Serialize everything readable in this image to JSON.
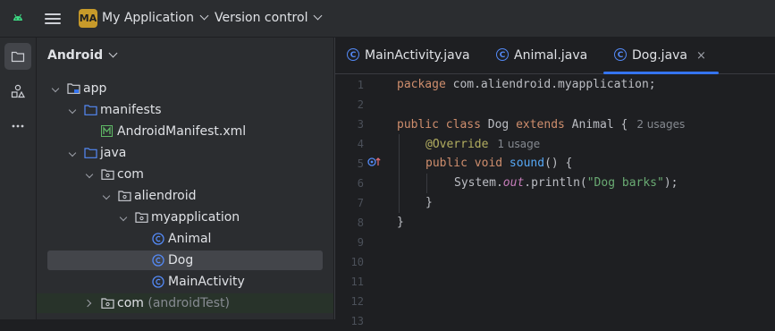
{
  "topbar": {
    "project_badge": "MA",
    "project_name": "My Application",
    "vcs_label": "Version control"
  },
  "project_panel": {
    "title": "Android",
    "tree": [
      {
        "label": "app",
        "icon": "module-folder-icon",
        "expanded": true
      },
      {
        "label": "manifests",
        "icon": "folder-icon",
        "expanded": true
      },
      {
        "label": "AndroidManifest.xml",
        "icon": "manifest-file-icon"
      },
      {
        "label": "java",
        "icon": "folder-icon",
        "expanded": true
      },
      {
        "label": "com",
        "icon": "package-icon",
        "expanded": true
      },
      {
        "label": "aliendroid",
        "icon": "package-icon",
        "expanded": true
      },
      {
        "label": "myapplication",
        "icon": "package-icon",
        "expanded": true
      },
      {
        "label": "Animal",
        "icon": "class-icon"
      },
      {
        "label": "Dog",
        "icon": "class-icon",
        "selected": true
      },
      {
        "label": "MainActivity",
        "icon": "class-icon"
      },
      {
        "label": "com",
        "suffix": "(androidTest)",
        "icon": "package-icon",
        "expanded": false
      }
    ]
  },
  "editor": {
    "tabs": [
      {
        "label": "MainActivity.java",
        "active": false
      },
      {
        "label": "Animal.java",
        "active": false
      },
      {
        "label": "Dog.java",
        "active": true,
        "close": "×"
      }
    ],
    "line_numbers": [
      "1",
      "2",
      "3",
      "4",
      "5",
      "6",
      "7",
      "8",
      "9",
      "10",
      "11",
      "12",
      "13"
    ],
    "code": {
      "l1_kw": "package",
      "l1_rest": " com.aliendroid.myapplication;",
      "l3_kw1": "public class",
      "l3_name": " Dog ",
      "l3_kw2": "extends",
      "l3_rest": " Animal {",
      "l3_hint": "2 usages",
      "l4_ann": "@Override",
      "l4_hint": "1 usage",
      "l5_kw": "public void",
      "l5_fn": " sound",
      "l5_rest": "() {",
      "l6_pre": "System.",
      "l6_fld": "out",
      "l6_mid": ".println(",
      "l6_str": "\"Dog barks\"",
      "l6_end": ");",
      "l7": "}",
      "l8": "}"
    }
  },
  "colors": {
    "keyword": "#cf8e6d",
    "annotation": "#b3ae60",
    "method": "#56a8f5",
    "string": "#6aab73",
    "accent": "#3574f0",
    "badge": "#c79a2a"
  }
}
